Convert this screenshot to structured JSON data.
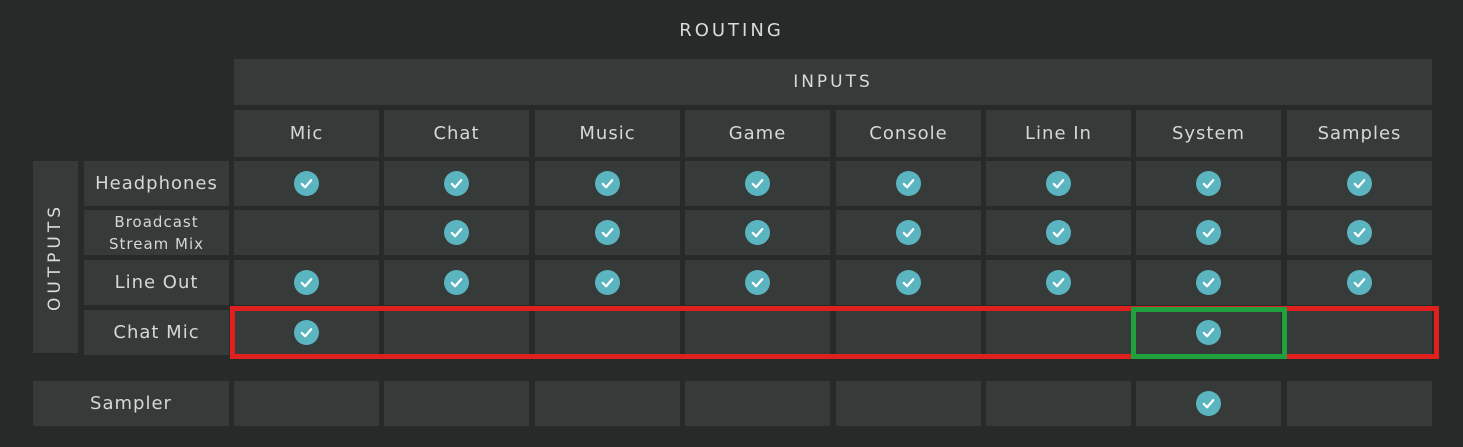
{
  "title": "ROUTING",
  "inputs_label": "INPUTS",
  "outputs_label": "OUTPUTS",
  "columns": [
    "Mic",
    "Chat",
    "Music",
    "Game",
    "Console",
    "Line In",
    "System",
    "Samples"
  ],
  "rows": [
    {
      "label": "Headphones",
      "checked": [
        true,
        true,
        true,
        true,
        true,
        true,
        true,
        true
      ]
    },
    {
      "label_line1": "Broadcast",
      "label_line2": "Stream Mix",
      "checked": [
        false,
        true,
        true,
        true,
        true,
        true,
        true,
        true
      ]
    },
    {
      "label": "Line Out",
      "checked": [
        true,
        true,
        true,
        true,
        true,
        true,
        true,
        true
      ]
    },
    {
      "label": "Chat Mic",
      "checked": [
        true,
        false,
        false,
        false,
        false,
        false,
        true,
        false
      ]
    }
  ],
  "sampler": {
    "label": "Sampler",
    "checked": [
      false,
      false,
      false,
      false,
      false,
      false,
      true,
      false
    ]
  },
  "colors": {
    "background": "#262a29",
    "cell": "#363b3a",
    "check": "#5bb5c1",
    "highlight_row": "#e0201e",
    "highlight_cell": "#1fa23e"
  }
}
